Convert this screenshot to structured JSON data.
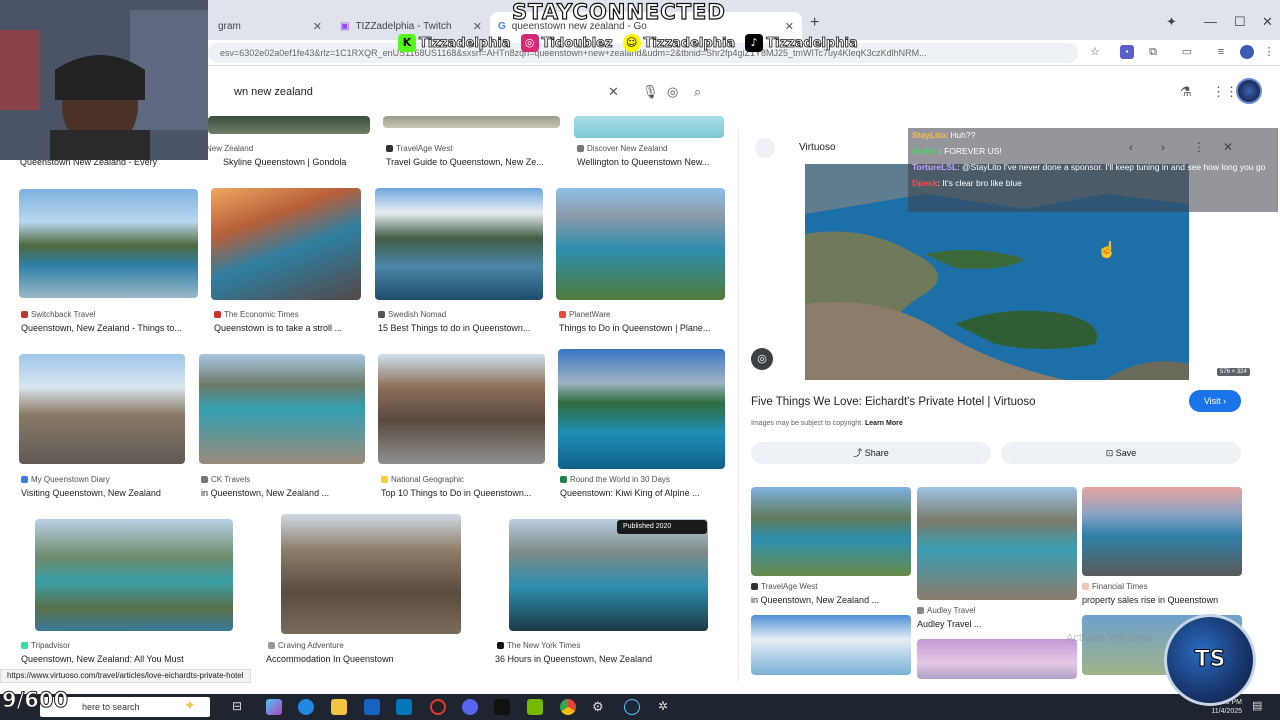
{
  "overlay": {
    "title": "STAYCONNECTED",
    "socials": [
      {
        "icon": "kick-icon",
        "handle": "Tizzadelphia",
        "color": "#53fc18"
      },
      {
        "icon": "instagram-icon",
        "handle": "Tidoublez",
        "color": "#d62976"
      },
      {
        "icon": "snapchat-icon",
        "handle": "Tizzadelphia",
        "color": "#fffc00"
      },
      {
        "icon": "tiktok-icon",
        "handle": "Tizzadelphia",
        "color": "#000000"
      }
    ],
    "sub_counter": "9/600",
    "badge_text": "TS",
    "watermark": "Activate Windows"
  },
  "chat": [
    {
      "user": "StayLito",
      "msg": ": Huh??"
    },
    {
      "user": "BotRix",
      "msg": ": FOREVER US!"
    },
    {
      "user": "TortureLSL",
      "msg": ": @StayLito I've never done a sponsor. I'll keep tuning in and see how long you go"
    },
    {
      "user": "Dpesk",
      "msg": ": It's clear bro like blue"
    }
  ],
  "browser": {
    "tabs": [
      {
        "label": "gram",
        "active": false
      },
      {
        "label": "TIZZadelphia - Twitch",
        "active": false
      },
      {
        "label": "queenstown new zealand - Go",
        "active": true
      }
    ],
    "url": "esv=6302e02a0ef1fe43&rlz=1C1RXQR_enUS1168US1168&sxsrf=AHTn8zqn=queenstown+new+zealand&udm=2&tbnid=Shr2fp4giZ1Y8MJ25_tmWITc7uy4KleqK3czKdlhNRM..."
  },
  "search": {
    "query": "wn new zealand"
  },
  "results": {
    "row0": [
      {
        "source": "New Zealand",
        "title": "Queenstown New Zealand - Every"
      },
      {
        "source": "TravelAge West",
        "title": "Skyline Queenstown | Gondola"
      },
      {
        "source": "TravelAge West",
        "title": "Travel Guide to Queenstown, New Ze..."
      },
      {
        "source": "Discover New Zealand",
        "title": "Wellington to Queenstown New..."
      }
    ],
    "row1": [
      {
        "source": "Switchback Travel",
        "title": "Queenstown, New Zealand - Things to..."
      },
      {
        "source": "The Economic Times",
        "title": "Queenstown is to take a stroll ..."
      },
      {
        "source": "Swedish Nomad",
        "title": "15 Best Things to do in Queenstown..."
      },
      {
        "source": "PlanetWare",
        "title": "Things to Do in Queenstown | Plane..."
      }
    ],
    "row2": [
      {
        "source": "My Queenstown Diary",
        "title": "Visiting Queenstown, New Zealand"
      },
      {
        "source": "CK Travels",
        "title": "in Queenstown, New Zealand ..."
      },
      {
        "source": "National Geographic",
        "title": "Top 10 Things to Do in Queenstown..."
      },
      {
        "source": "Round the World in 30 Days",
        "title": "Queenstown: Kiwi King of Alpine ..."
      }
    ],
    "row3": [
      {
        "source": "Tripadvisor",
        "title": "Queenstown, New Zealand: All You Must"
      },
      {
        "source": "Craving Adventure",
        "title": "Accommodation In Queenstown"
      },
      {
        "source": "The New York Times",
        "title": "36 Hours in Queenstown, New Zealand"
      }
    ],
    "published_badge": "Published 2020"
  },
  "preview": {
    "site": "Virtuoso",
    "size": "576 × 324",
    "title": "Five Things We Love: Eichardt's Private Hotel | Virtuoso",
    "visit": "Visit",
    "copyright": "Images may be subject to copyright.",
    "learn_more": "Learn More",
    "share": "Share",
    "save": "Save",
    "related": [
      {
        "source": "TravelAge West",
        "title": "in Queenstown, New Zealand ..."
      },
      {
        "source": "Audley Travel",
        "title": "Audley Travel ..."
      },
      {
        "source": "Financial Times",
        "title": "property sales rise in Queenstown"
      }
    ]
  },
  "status_url": "https://www.virtuoso.com/travel/articles/love-eichardts-private-hotel",
  "taskbar": {
    "search_placeholder": "here to search",
    "time": "1:55 PM",
    "date": "11/4/2025"
  }
}
